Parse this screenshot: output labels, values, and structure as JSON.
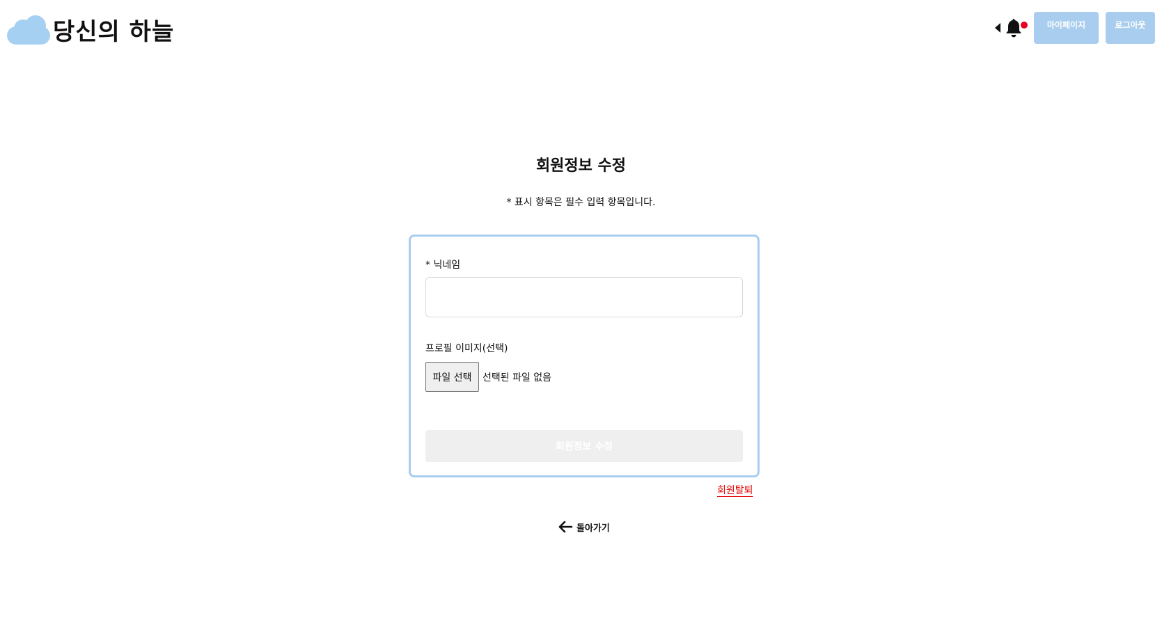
{
  "header": {
    "logo_text": "당신의 하늘",
    "notification_has_unread": true,
    "mypage_label": "마이페이지",
    "logout_label": "로그아웃"
  },
  "main": {
    "title": "회원정보 수정",
    "subtitle": "* 표시 항목은 필수 입력 항목입니다.",
    "form": {
      "nickname_label": "* 닉네임",
      "nickname_value": "",
      "profile_label": "프로필 이미지(선택)",
      "file_button_label": "파일 선택",
      "file_status": "선택된 파일 없음",
      "submit_label": "회원정보 수정"
    },
    "withdraw_label": "회원탈퇴",
    "back_label": "돌아가기"
  },
  "colors": {
    "accent": "#a8cdee",
    "logo_cloud": "#a6d0f2",
    "notification_dot": "#e60023",
    "withdraw_link": "#e60000",
    "disabled_button": "#efefef"
  },
  "icons": [
    "cloud-logo-icon",
    "caret-left-icon",
    "bell-icon",
    "arrow-left-icon"
  ]
}
